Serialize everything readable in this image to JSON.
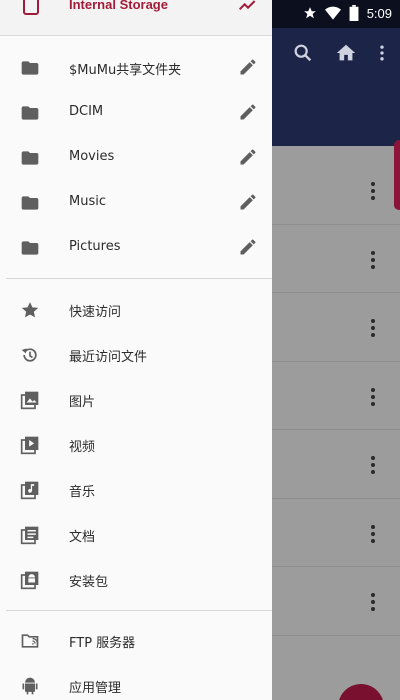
{
  "status_bar": {
    "time": "5:09",
    "icons": [
      "star-icon",
      "wifi-icon",
      "battery-icon"
    ]
  },
  "background_app": {
    "toolbar_icons": [
      "search-icon",
      "home-icon",
      "overflow-menu-icon"
    ],
    "row_count": 7
  },
  "drawer": {
    "header_title": "Internal Storage",
    "storage_folders": [
      {
        "label": "$MuMu共享文件夹",
        "icon": "folder-icon"
      },
      {
        "label": "DCIM",
        "icon": "folder-icon"
      },
      {
        "label": "Movies",
        "icon": "folder-icon"
      },
      {
        "label": "Music",
        "icon": "folder-icon"
      },
      {
        "label": "Pictures",
        "icon": "folder-icon"
      }
    ],
    "categories": [
      {
        "label": "快速访问",
        "icon": "star-icon"
      },
      {
        "label": "最近访问文件",
        "icon": "history-icon"
      },
      {
        "label": "图片",
        "icon": "image-icon"
      },
      {
        "label": "视频",
        "icon": "video-icon"
      },
      {
        "label": "音乐",
        "icon": "music-icon"
      },
      {
        "label": "文档",
        "icon": "document-icon"
      },
      {
        "label": "安装包",
        "icon": "apk-icon"
      }
    ],
    "tools": [
      {
        "label": "FTP 服务器",
        "icon": "ftp-folder-icon"
      },
      {
        "label": "应用管理",
        "icon": "android-icon"
      }
    ]
  },
  "colors": {
    "toolbar": "#1c2547",
    "accent": "#a11c3a",
    "icon_gray": "#5f5f5f",
    "drawer_bg": "#fafafa"
  }
}
